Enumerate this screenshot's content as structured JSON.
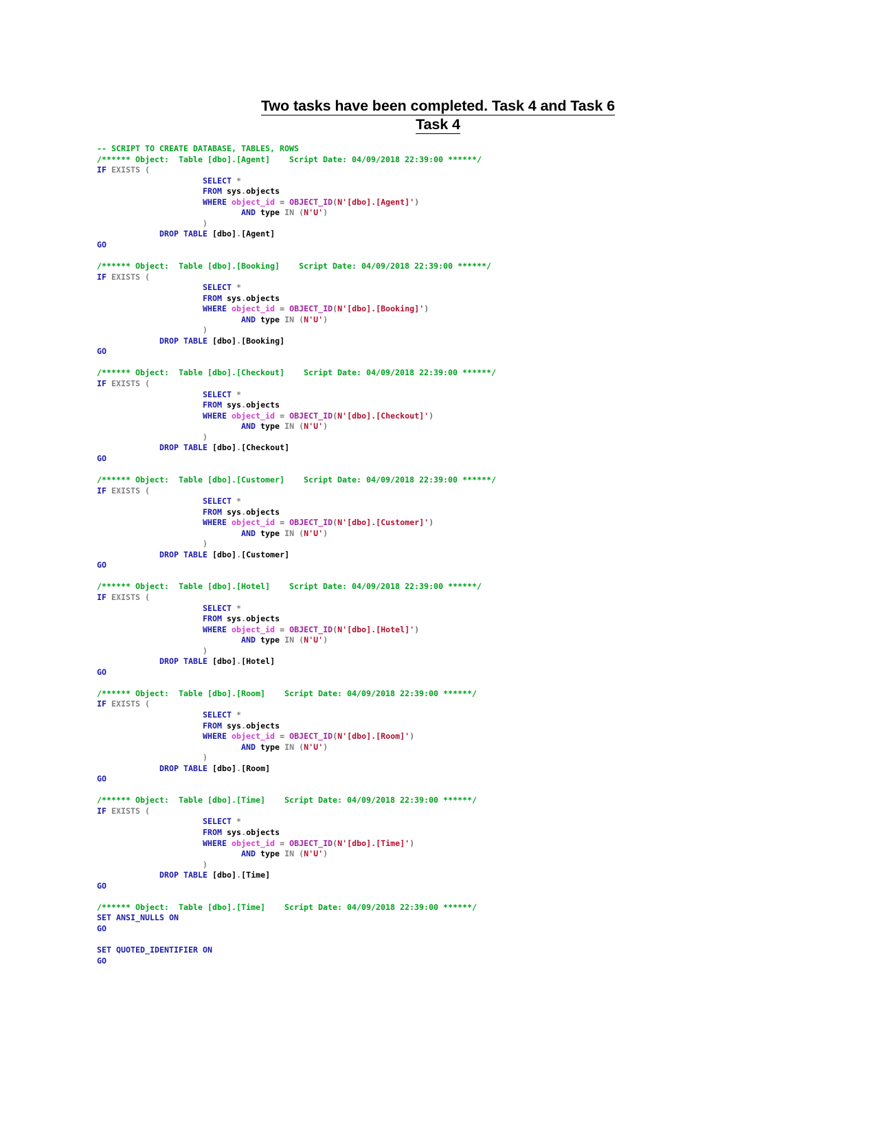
{
  "document": {
    "title": "Two tasks have been completed. Task 4 and Task 6",
    "subtitle": "Task 4"
  },
  "colors": {
    "comment": "#00A01E",
    "keyword": "#1A1AA6",
    "identifier": "#D23BD2",
    "function": "#A020A0",
    "string": "#B01030",
    "plain": "#000000",
    "gray": "#808080",
    "background": "#FFFFFF"
  },
  "code": {
    "language": "SQL",
    "header_comment": "-- SCRIPT TO CREATE DATABASE, TABLES, ROWS",
    "script_date": "04/09/2018 22:39:00",
    "schema": "dbo",
    "tables": [
      "Agent",
      "Booking",
      "Checkout",
      "Customer",
      "Hotel",
      "Room",
      "Time"
    ],
    "block_comment_prefix": "/****** Object:  Table [dbo].[",
    "block_comment_suffix": "]    Script Date: 04/09/2018 22:39:00 ******/",
    "lines": {
      "if_exists": "IF EXISTS (",
      "select_star": "SELECT *",
      "from_sys": "FROM sys.objects",
      "where_prefix": "WHERE object_id = OBJECT_ID(N'[dbo].[",
      "where_suffix": "]')",
      "and_type": "AND type IN (N'U')",
      "close_paren": ")",
      "drop_table_prefix": "DROP TABLE [dbo].[",
      "drop_table_suffix": "]",
      "go": "GO"
    },
    "trailer": {
      "comment": "/****** Object:  Table [dbo].[Time]    Script Date: 04/09/2018 22:39:00 ******/",
      "set_ansi_nulls": "SET ANSI_NULLS ON",
      "go_1": "GO",
      "set_quoted_identifier": "SET QUOTED_IDENTIFIER ON",
      "go_2": "GO"
    }
  }
}
